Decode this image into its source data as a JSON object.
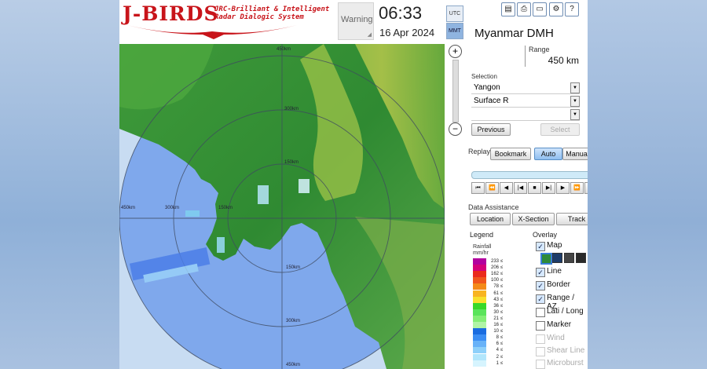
{
  "app": {
    "logo": "J-BIRDS",
    "logo_sub1": "JRC-Brilliant & Intelligent",
    "logo_sub2": "Radar Dialogic System"
  },
  "header": {
    "warning_label": "Warning",
    "time": "06:33",
    "date": "16 Apr 2024",
    "tz_utc": "UTC",
    "tz_mmt": "MMT",
    "toolbar_icons": [
      "save-icon",
      "print-icon",
      "folder-icon",
      "settings-icon",
      "help-icon"
    ]
  },
  "panel": {
    "title": "Myanmar DMH",
    "range_label": "Range",
    "range_value": "450 km",
    "selection_label": "Selection",
    "selection_1": "Yangon",
    "selection_2": "Surface R",
    "selection_3": "",
    "previous_label": "Previous",
    "select_label": "Select",
    "replay_label": "Replay",
    "bookmark_label": "Bookmark",
    "auto_label": "Auto",
    "manual_label": "Manual",
    "data_assistance_label": "Data Assistance",
    "location_label": "Location",
    "xsection_label": "X-Section",
    "track_label": "Track"
  },
  "legend": {
    "title": "Legend",
    "units_line1": "Rainfall",
    "units_line2": "mm/hr",
    "le_symbol": "≤",
    "entries": [
      {
        "value": "233",
        "color": "#b2009e"
      },
      {
        "value": "206",
        "color": "#d4007a"
      },
      {
        "value": "162",
        "color": "#ea2a1c"
      },
      {
        "value": "100",
        "color": "#f0561c"
      },
      {
        "value": "78",
        "color": "#f48a18"
      },
      {
        "value": "61",
        "color": "#f8b420"
      },
      {
        "value": "43",
        "color": "#f8e02c"
      },
      {
        "value": "36",
        "color": "#38d828"
      },
      {
        "value": "30",
        "color": "#5ae45a"
      },
      {
        "value": "21",
        "color": "#84ee76"
      },
      {
        "value": "16",
        "color": "#b0f4a6"
      },
      {
        "value": "10",
        "color": "#1a6ce0"
      },
      {
        "value": "8",
        "color": "#3c8ef4"
      },
      {
        "value": "6",
        "color": "#68b2f8"
      },
      {
        "value": "4",
        "color": "#8ed0fa"
      },
      {
        "value": "2",
        "color": "#b2e6fc"
      },
      {
        "value": "1",
        "color": "#d6f4fe"
      }
    ]
  },
  "overlay": {
    "title": "Overlay",
    "items": [
      {
        "label": "Map",
        "checked": true,
        "enabled": true
      },
      {
        "label": "Line",
        "checked": true,
        "enabled": true
      },
      {
        "label": "Border",
        "checked": true,
        "enabled": true
      },
      {
        "label": "Range / AZ",
        "checked": true,
        "enabled": true
      },
      {
        "label": "Lati / Long",
        "checked": false,
        "enabled": true
      },
      {
        "label": "Marker",
        "checked": false,
        "enabled": true
      },
      {
        "label": "Wind",
        "checked": false,
        "enabled": false
      },
      {
        "label": "Shear Line",
        "checked": false,
        "enabled": false
      },
      {
        "label": "Microburst",
        "checked": false,
        "enabled": false
      }
    ]
  },
  "map": {
    "range_labels": [
      "450km",
      "300km",
      "150km",
      "150km",
      "300km",
      "450km",
      "450km",
      "300km",
      "150km"
    ]
  }
}
